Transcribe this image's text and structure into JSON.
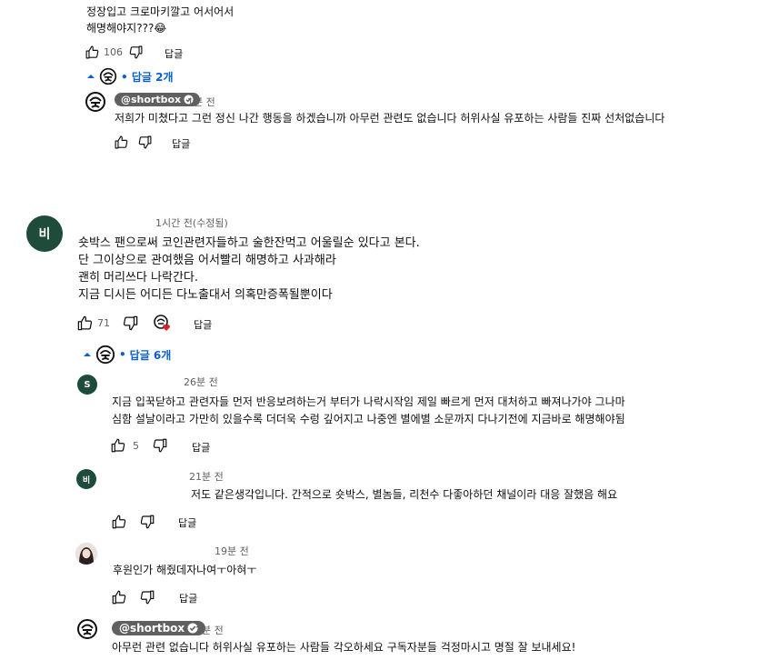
{
  "top_comment": {
    "lines": [
      "정장입고 크로마키깔고 어서어서",
      "해명해야지???😂"
    ],
    "likes": "106",
    "reply_label": "답글"
  },
  "thread1_toggle": {
    "label": "• 답글 2개"
  },
  "reply_a": {
    "author": "@shortbox",
    "time": "1분 전",
    "text": "저희가 미쳤다고 그런 정신 나간 행동을 하겠습니까 아무런 관련도 없습니다 허위사실 유포하는 사람들 진짜 선처없습니다",
    "reply_label": "답글"
  },
  "comment2": {
    "avatar_letter": "비",
    "time": "1시간 전(수정됨)",
    "lines": [
      "숏박스 팬으로써 코인관련자들하고 술한잔먹고 어울릴순 있다고 본다.",
      "단 그이상으로 관여했음 어서빨리 해명하고 사과해라",
      "괜히 머리쓰다 나락간다.",
      "지금 디시든 어디든 다노출대서 의혹만증폭될뿐이다"
    ],
    "likes": "71",
    "reply_label": "답글"
  },
  "thread2_toggle": {
    "label": "답글 6개"
  },
  "reply_s": {
    "avatar_letter": "S",
    "time": "26분 전",
    "lines": [
      "지금 입꾹닫하고 관련자들 먼저 반응보려하는거 부터가 나락시작임 제일 빠르게 먼저 대처하고 빠져나가야 그나마",
      "심함 설날이라고 가만히 있을수록 더더욱 수렁 깊어지고 나중엔 별에별 소문까지 다나기전에 지금바로 해명해야됨"
    ],
    "likes": "5",
    "reply_label": "답글"
  },
  "reply_b": {
    "avatar_letter": "비",
    "time": "21분 전",
    "text": "저도 같은생각입니다. 간적으로 숏박스, 별놈들, 리천수 다좋아하던 채널이라 대응 잘했음 해요",
    "reply_label": "답글"
  },
  "reply_c": {
    "time": "19분 전",
    "text": "후원인가 해줬데자나여ㅜ아혀ㅜ",
    "reply_label": "답글"
  },
  "reply_d": {
    "author": "@shortbox",
    "time": "2분 전",
    "text": "아무런 관련 없습니다 허위사실 유포하는 사람들 각오하세요 구독자분들 걱정마시고 명절 잘 보내세요!"
  }
}
